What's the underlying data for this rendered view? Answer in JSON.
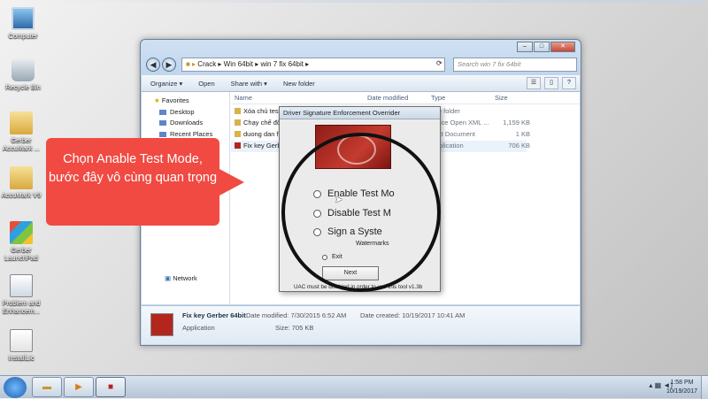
{
  "desktop": {
    "icons": [
      {
        "label": "Computer",
        "icon": "computer-icon"
      },
      {
        "label": "Recycle Bin",
        "icon": "recycle-bin-icon"
      },
      {
        "label": "Gerber AccuMark ...",
        "icon": "folder-icon"
      },
      {
        "label": "AccuMark V9",
        "icon": "folder-icon"
      },
      {
        "label": "Gerber LaunchPad",
        "icon": "launchpad-icon"
      },
      {
        "label": "Problem and Enhancem...",
        "icon": "document-icon"
      },
      {
        "label": "InstallLic",
        "icon": "installer-icon"
      }
    ]
  },
  "explorer": {
    "address_path": [
      "Crack",
      "Win 64bit",
      "win 7 fix 64bit"
    ],
    "search_placeholder": "Search win 7 fix 64bit",
    "toolbar": {
      "organize": "Organize ▾",
      "open": "Open",
      "share_with": "Share with ▾",
      "new_folder": "New folder"
    },
    "nav": {
      "favorites": "Favorites",
      "desktop": "Desktop",
      "downloads": "Downloads",
      "recent_places": "Recent Places",
      "network": "Network"
    },
    "columns": {
      "name": "Name",
      "date_modified": "Date modified",
      "type": "Type",
      "size": "Size"
    },
    "files": [
      {
        "name": "Xóa chủ test",
        "type": "File folder",
        "size": ""
      },
      {
        "name": "Chạy chế độ",
        "type": "Office Open XML ...",
        "size": "1,159 KB"
      },
      {
        "name": "duong dan fi",
        "type": "Text Document",
        "size": "1 KB"
      },
      {
        "name": "Fix key Gerber",
        "type": "Application",
        "size": "706 KB"
      }
    ],
    "details": {
      "name": "Fix key Gerber 64bit",
      "type": "Application",
      "date_modified": "Date modified: 7/30/2015 6:52 AM",
      "size": "Size: 705 KB",
      "date_created": "Date created: 10/19/2017 10:41 AM"
    }
  },
  "dialog": {
    "title": "Driver Signature Enforcement Overrider",
    "options": [
      {
        "label": "Enable Test Mo"
      },
      {
        "label": "Disable Test M"
      },
      {
        "label": "Sign a Syste"
      }
    ],
    "watermarks_label": "Watermarks",
    "exit_label": "Exit",
    "next_label": "Next",
    "uac_note": "UAC must be disabled in order to use this tool    v1.3b"
  },
  "callout": {
    "text": "Chọn Anable Test Mode, bước đây vô cùng quan trọng",
    "color": "#f04a43"
  },
  "taskbar": {
    "time": "1:58 PM",
    "date": "10/19/2017"
  }
}
